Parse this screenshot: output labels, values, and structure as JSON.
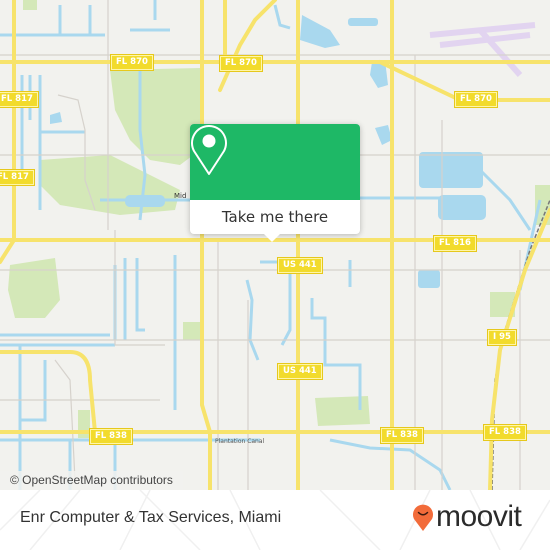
{
  "map": {
    "attribution": "© OpenStreetMap contributors",
    "colors": {
      "land": "#f2f2ee",
      "water": "#a9d8ee",
      "park": "#d4e8b8",
      "major_road": "#f7e36b",
      "minor_road": "#d6d2cc",
      "airport": "#e8dcf2",
      "rail": "#777777"
    },
    "road_shields": [
      {
        "label": "FL 870"
      },
      {
        "label": "FL 870"
      },
      {
        "label": "FL 870"
      },
      {
        "label": "FL 817"
      },
      {
        "label": "FL 817"
      },
      {
        "label": "FL 816"
      },
      {
        "label": "US 441"
      },
      {
        "label": "US 441"
      },
      {
        "label": "I 95"
      },
      {
        "label": "FL 838"
      },
      {
        "label": "FL 838"
      },
      {
        "label": "FL 838"
      }
    ],
    "place_labels": [
      {
        "label": "Mid"
      },
      {
        "label": "Plantation Canal"
      }
    ]
  },
  "popup": {
    "icon": "map-pin-icon",
    "button_label": "Take me there",
    "color": "#1eb866"
  },
  "footer": {
    "place_name": "Enr Computer & Tax Services, Miami",
    "brand": "moovit",
    "brand_color": "#f26b3a"
  }
}
